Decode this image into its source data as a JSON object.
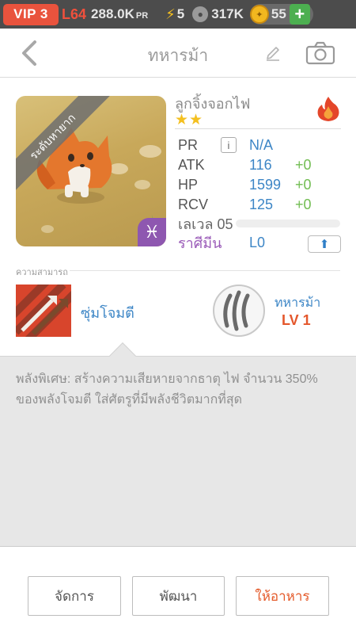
{
  "statusbar": {
    "vip": "VIP 3",
    "level": "L64",
    "pr_value": "288.0K",
    "pr_unit": "PR",
    "energy": "5",
    "paw_count": "317K",
    "coins": "55",
    "plus": "+"
  },
  "header": {
    "title": "ทหารม้า"
  },
  "card": {
    "ribbon": "ระดับหายาก",
    "element_symbol": "♓",
    "name": "ลูกจิ้งจอกไฟ",
    "stars": "★★",
    "stats": [
      {
        "label": "PR",
        "value": "N/A",
        "bonus": ""
      },
      {
        "label": "ATK",
        "value": "116",
        "bonus": "+0"
      },
      {
        "label": "HP",
        "value": "1599",
        "bonus": "+0"
      },
      {
        "label": "RCV",
        "value": "125",
        "bonus": "+0"
      }
    ],
    "info_glyph": "i",
    "level_label": "เลเวล 05",
    "zodiac_label": "ราศีมีน",
    "zodiac_value": "L0",
    "upgrade_glyph": "⬆"
  },
  "ability": {
    "section_label": "ความสามารถ",
    "skill_name": "ซุ่มโจมตี",
    "leader_name": "ทหารม้า",
    "leader_level": "LV 1"
  },
  "description": {
    "text": "พลังพิเศษ: สร้างความเสียหายจากธาตุ ไฟ จำนวน 350% ของพลังโจมตี ใส่ศัตรูที่มีพลังชีวิตมากที่สุด"
  },
  "footer": {
    "manage": "จัดการ",
    "develop": "พัฒนา",
    "feed": "ให้อาหาร"
  },
  "colors": {
    "accent_blue": "#3d86c6",
    "accent_orange": "#e45a2a",
    "bonus_green": "#72bd52",
    "vip_red": "#e9533d"
  }
}
